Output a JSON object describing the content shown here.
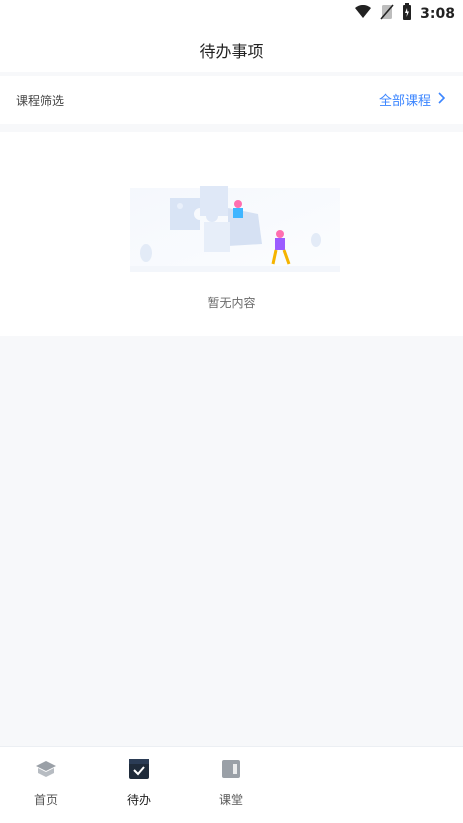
{
  "status_bar": {
    "time": "3:08",
    "icons": [
      "wifi-icon",
      "no-sim-icon",
      "battery-icon"
    ]
  },
  "header": {
    "title": "待办事项"
  },
  "filter": {
    "label": "课程筛选",
    "link": "全部课程"
  },
  "empty_state": {
    "illustration": "puzzle-illustration",
    "text": "暂无内容"
  },
  "tabs": [
    {
      "label": "首页",
      "icon": "home-icon"
    },
    {
      "label": "待办",
      "icon": "todo-icon",
      "active": true
    },
    {
      "label": "课堂",
      "icon": "classroom-icon"
    }
  ],
  "colors": {
    "accent": "#3c86ff",
    "background": "#f7f8fa",
    "card": "#ffffff",
    "tab_active": "#1f2b3a",
    "tab_inactive": "#9aa0a7"
  }
}
